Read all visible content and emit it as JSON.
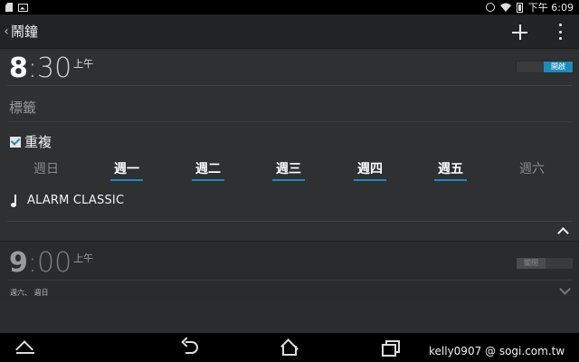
{
  "status_bar": {
    "time": "下午 6:09"
  },
  "action_bar": {
    "title": "鬧鐘"
  },
  "alarms": [
    {
      "hour": "8",
      "minute_text": ":30",
      "ampm": "上午",
      "toggle_label": "開啟",
      "label_placeholder": "標籤",
      "repeat_label": "重複",
      "repeat_checked": true,
      "days": [
        {
          "label": "週日",
          "enabled": false
        },
        {
          "label": "週一",
          "enabled": true
        },
        {
          "label": "週二",
          "enabled": true
        },
        {
          "label": "週三",
          "enabled": true
        },
        {
          "label": "週四",
          "enabled": true
        },
        {
          "label": "週五",
          "enabled": true
        },
        {
          "label": "週六",
          "enabled": false
        }
      ],
      "ringtone": "ALARM CLASSIC"
    },
    {
      "hour": "9",
      "minute_text": ":00",
      "ampm": "上午",
      "toggle_label": "關閉",
      "days_summary": "週六、 週日"
    }
  ],
  "watermark": "kelly0907  @ sogi.com.tw",
  "colors": {
    "accent": "#1e8bbd",
    "background": "#2b2c2e",
    "action_bar": "#222325"
  },
  "icons": [
    "back-chevron-icon",
    "add-icon",
    "overflow-menu-icon",
    "checkbox-icon",
    "music-note-icon",
    "chevron-up-icon",
    "chevron-down-icon",
    "nav-menu-icon",
    "nav-back-icon",
    "nav-home-icon",
    "nav-recent-apps-icon"
  ]
}
